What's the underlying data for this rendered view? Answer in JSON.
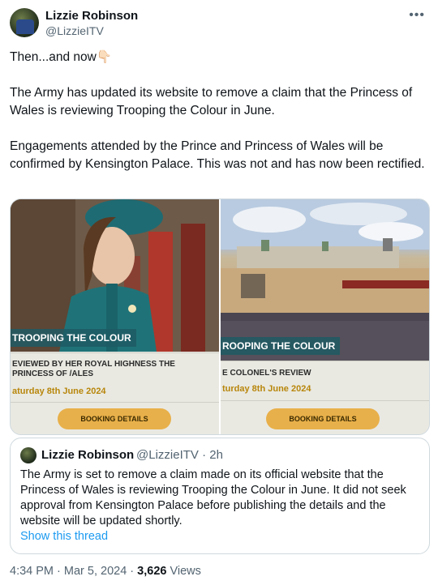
{
  "author": {
    "name": "Lizzie Robinson",
    "handle": "@LizzieITV"
  },
  "more_icon": "more-horizontal-icon",
  "tweet": {
    "para1": "Then...and now👇🏻",
    "para2": "The Army has updated its website to remove a claim that the Princess of Wales is reviewing Trooping the Colour in June.",
    "para3": "Engagements attended by the Prince and Princess of Wales will be confirmed by Kensington Palace. This was not and has now been rectified."
  },
  "media": {
    "left": {
      "banner": "TROOPING THE COLOUR",
      "event": "EVIEWED BY HER ROYAL HIGHNESS THE PRINCESS OF /ALES",
      "date": "aturday 8th June 2024",
      "button": "BOOKING DETAILS"
    },
    "right": {
      "banner": "ROOPING THE COLOUR",
      "event": "E COLONEL'S REVIEW",
      "date": "turday 8th June 2024",
      "button": "BOOKING DETAILS"
    }
  },
  "quote": {
    "name": "Lizzie Robinson",
    "handle_time": "@LizzieITV · 2h",
    "text": "The Army is set to remove a claim made on its official website that the Princess of Wales is reviewing Trooping the Colour in June. It did not seek approval from Kensington Palace before publishing the details and the website will be updated shortly.",
    "link": "Show this thread"
  },
  "footer": {
    "time_date": "4:34 PM · Mar 5, 2024 · ",
    "views_count": "3,626",
    "views_label": " Views"
  },
  "colors": {
    "link": "#1d9bf0",
    "muted": "#536471",
    "button": "#e8b04a",
    "banner": "#1e5a64"
  }
}
